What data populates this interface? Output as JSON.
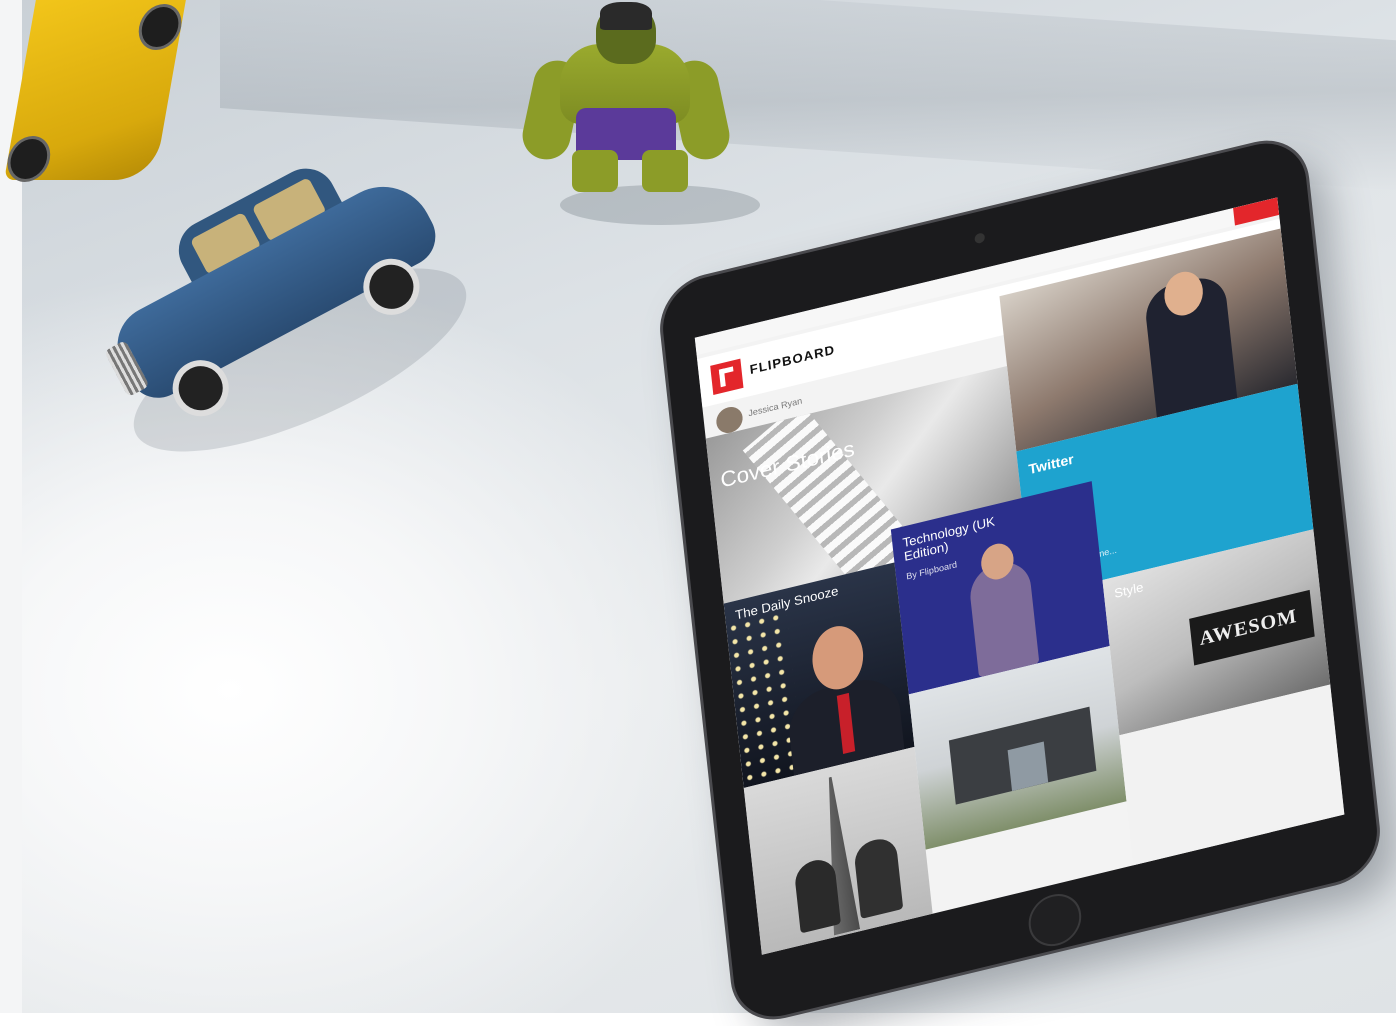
{
  "app": {
    "name": "FLIPBOARD",
    "profile_name": "Jessica Ryan",
    "status_accent": "#e3262b"
  },
  "tiles": [
    {
      "id": "cover-stories",
      "title": "Cover Stories",
      "color": "#9a9a9a"
    },
    {
      "id": "daily-news",
      "title": "",
      "color": "#8e7a6e"
    },
    {
      "id": "twitter",
      "title": "Twitter",
      "subtitle": "Add your timeline...",
      "color": "#1ea3cf"
    },
    {
      "id": "technology",
      "title": "Technology (UK Edition)",
      "subtitle": "By Flipboard",
      "color": "#2b2f8c"
    },
    {
      "id": "the-daily-snooze",
      "title": "The Daily Snooze",
      "color": "#1c1f2a"
    },
    {
      "id": "style",
      "title": "Style",
      "sign_text": "AWESOM",
      "color": "#bdbdbd"
    },
    {
      "id": "house",
      "title": "",
      "color": "#cfd3d6"
    },
    {
      "id": "paris",
      "title": "",
      "color": "#b9b9b9"
    }
  ],
  "scene": {
    "surface_color": "#e0e4e7",
    "tablet_bezel_color": "#1b1b1d",
    "objects": [
      "toy-taxi",
      "hulk-figure",
      "blue-toy-car",
      "tablet"
    ]
  }
}
